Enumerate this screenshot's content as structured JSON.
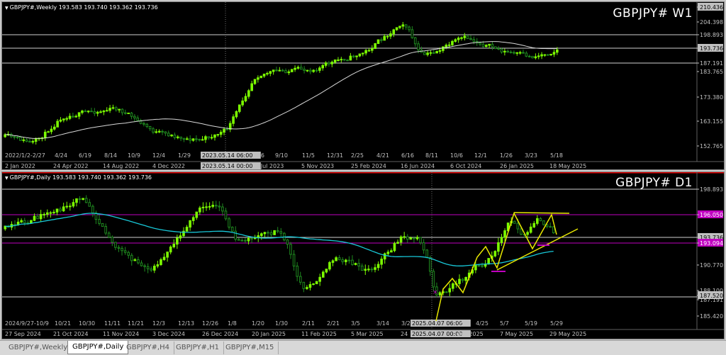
{
  "colors": {
    "background": "#000000",
    "bull_candle": "#7cfc00",
    "bear_candle": "#1f8a1f",
    "grid_text": "#c0c0c0",
    "ma_white": "#d8d8d8",
    "ma_cyan": "#18c8d8",
    "zigzag_yellow": "#e8e800",
    "level_magenta": "#c000c0",
    "price_box": "#c0c0c0",
    "pane_border_red": "#e00000"
  },
  "weekly": {
    "ohlc_label": "GBPJPY#,Weekly  193.583 193.740 193.362 193.736",
    "big_title": "GBPJPY# W1",
    "price_labels": [
      "210.436",
      "204.398",
      "198.893",
      "193.736",
      "187.191",
      "183.765",
      "173.380",
      "163.155",
      "152.765"
    ],
    "top_dates": [
      "2022/1/2-2/27",
      "4/24",
      "6/19",
      "8/14",
      "10/9",
      "12/4",
      "1/29",
      "2023.05.14 06:00",
      "7/16",
      "9/10",
      "11/5",
      "12/31",
      "2/25",
      "4/21",
      "6/16",
      "8/11",
      "10/6",
      "12/1",
      "1/26",
      "3/23",
      "5/18"
    ],
    "bottom_dates": [
      "2 Jan 2022",
      "24 Apr 2022",
      "14 Aug 2022",
      "4 Dec 2022",
      "2023.05.14 00:00",
      "16 Jul 2023",
      "5 Nov 2023",
      "25 Feb 2024",
      "16 Jun 2024",
      "6 Oct 2024",
      "26 Jan 2025",
      "18 May 2025"
    ]
  },
  "daily": {
    "ohlc_label": "GBPJPY#,Daily  193.583 193.740 193.362 193.736",
    "big_title": "GBPJPY# D1",
    "price_labels": [
      "198.893",
      "196.050",
      "193.736",
      "193.094",
      "190.770",
      "188.100",
      "187.520",
      "187.191",
      "185.420"
    ],
    "top_dates": [
      "2024/9/27-10/9",
      "10/21",
      "10/30",
      "11/11",
      "11/21",
      "12/3",
      "12/13",
      "12/26",
      "1/8",
      "1/20",
      "1/30",
      "2/11",
      "2/21",
      "3/5",
      "3/14",
      "3/2",
      "2025.04.07 06:00",
      "15",
      "4/25",
      "5/7",
      "5/19",
      "5/29"
    ],
    "bottom_dates": [
      "27 Sep 2024",
      "21 Oct 2024",
      "11 Nov 2024",
      "3 Dec 2024",
      "26 Dec 2024",
      "20 Jan 2025",
      "11 Feb 2025",
      "5 Mar 2025",
      "24",
      "2025.04.07 00:00",
      "Apr 2025",
      "7 May 2025",
      "29 May 2025"
    ]
  },
  "tabs": [
    "GBPJPY#,Weekly",
    "GBPJPY#,Daily",
    "GBPJPY#,H4",
    "GBPJPY#,H1",
    "GBPJPY#,M15"
  ],
  "active_tab": "GBPJPY#,Daily"
}
